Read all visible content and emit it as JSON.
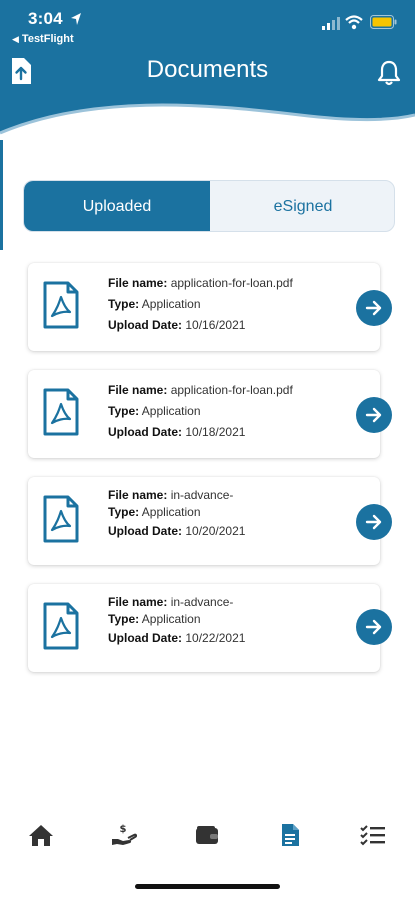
{
  "status_bar": {
    "time": "3:04",
    "back_app": "TestFlight",
    "battery_color": "#f5c400"
  },
  "header": {
    "title": "Documents",
    "left_icon": "upload-document-icon",
    "right_icon": "bell-icon",
    "color": "#1b72a0"
  },
  "tabs": {
    "uploaded_label": "Uploaded",
    "esigned_label": "eSigned",
    "selected": "Uploaded"
  },
  "documents": [
    {
      "file_name_label": "File name:",
      "file_name": "application-for-loan.pdf",
      "type_label": "Type:",
      "type": "Application",
      "date_label": "Upload Date:",
      "upload_date": "10/16/2021"
    },
    {
      "file_name_label": "File name:",
      "file_name": "application-for-loan.pdf",
      "type_label": "Type:",
      "type": "Application",
      "date_label": "Upload Date:",
      "upload_date": "10/18/2021"
    },
    {
      "file_name_label": "File name:",
      "file_name": "in-advance-",
      "type_label": "Type:",
      "type": "Application",
      "date_label": "Upload Date:",
      "upload_date": "10/20/2021"
    },
    {
      "file_name_label": "File name:",
      "file_name": "in-advance-",
      "type_label": "Type:",
      "type": "Application",
      "date_label": "Upload Date:",
      "upload_date": "10/22/2021"
    }
  ],
  "bottom_nav": [
    {
      "icon": "home-icon",
      "active": false
    },
    {
      "icon": "hand-dollar-icon",
      "active": false
    },
    {
      "icon": "wallet-icon",
      "active": false
    },
    {
      "icon": "document-icon",
      "active": true
    },
    {
      "icon": "checklist-icon",
      "active": false
    }
  ],
  "colors": {
    "primary": "#1b72a0",
    "nav_inactive": "#333333"
  }
}
